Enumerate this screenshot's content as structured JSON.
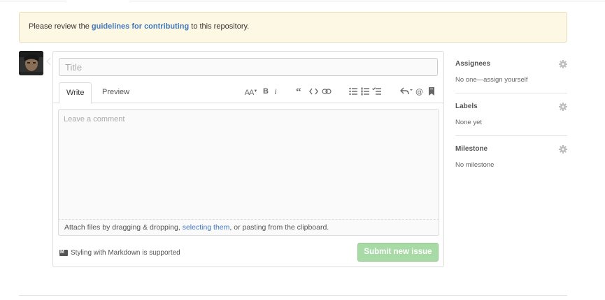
{
  "flash": {
    "prefix": "Please review the ",
    "link": "guidelines for contributing",
    "suffix": " to this repository."
  },
  "form": {
    "title_placeholder": "Title",
    "tabs": [
      {
        "label": "Write",
        "active": true
      },
      {
        "label": "Preview",
        "active": false
      }
    ],
    "toolbar": {
      "header_label": "AA",
      "bold_label": "B",
      "italic_label": "i"
    },
    "comment_placeholder": "Leave a comment",
    "attach": {
      "prefix": "Attach files by dragging & dropping, ",
      "link": "selecting them",
      "suffix": ", or pasting from the clipboard."
    },
    "markdown_note": "Styling with Markdown is supported",
    "submit_label": "Submit new issue"
  },
  "sidebar": {
    "assignees": {
      "heading": "Assignees",
      "value": "No one—assign yourself"
    },
    "labels": {
      "heading": "Labels",
      "value": "None yet"
    },
    "milestone": {
      "heading": "Milestone",
      "value": "No milestone"
    }
  },
  "colors": {
    "flash_bg": "#fdf8e4",
    "link": "#4078c0",
    "submit_bg": "#a3d9a1"
  }
}
